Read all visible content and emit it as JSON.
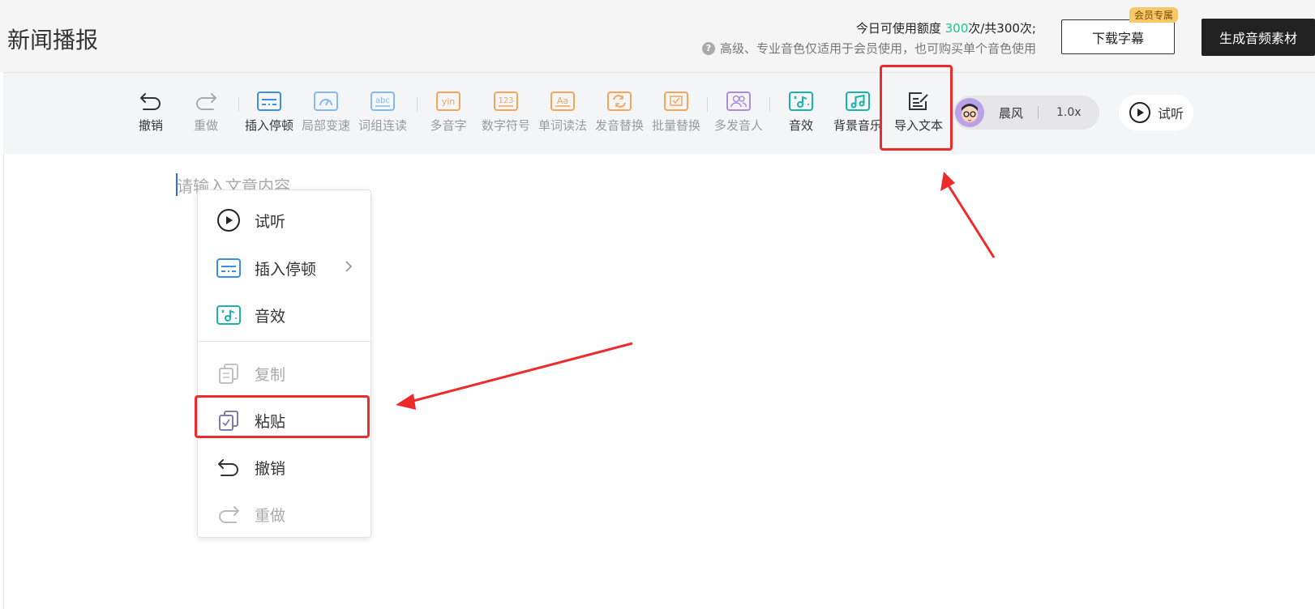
{
  "header": {
    "title": "新闻播报",
    "quota_prefix": "今日可使用额度 ",
    "quota_used": "300",
    "quota_suffix": "次/共300次;",
    "tip": "高级、专业音色仅适用于会员使用，也可购买单个音色使用",
    "download_label": "下载字幕",
    "member_badge": "会员专属",
    "generate_label": "生成音频素材"
  },
  "toolbar": {
    "undo": "撤销",
    "redo": "重做",
    "insert_pause": "插入停顿",
    "local_speed": "局部变速",
    "word_group": "词组连读",
    "polyphone": "多音字",
    "number_symbol": "数字符号",
    "word_reading": "单词读法",
    "pronunciation_replace": "发音替换",
    "batch_replace": "批量替换",
    "multi_speaker": "多发音人",
    "sound_effect": "音效",
    "bg_music": "背景音乐",
    "import_text": "导入文本"
  },
  "voice": {
    "name": "晨风",
    "speed": "1.0x"
  },
  "preview_label": "试听",
  "editor": {
    "placeholder": "请输入文章内容"
  },
  "context_menu": {
    "items": [
      {
        "label": "试听",
        "icon": "play-icon",
        "enabled": true
      },
      {
        "label": "插入停顿",
        "icon": "pause-insert-icon",
        "enabled": true,
        "submenu": true
      },
      {
        "label": "音效",
        "icon": "sound-effect-icon",
        "enabled": true
      },
      {
        "label": "复制",
        "icon": "copy-icon",
        "enabled": false
      },
      {
        "label": "粘贴",
        "icon": "paste-icon",
        "enabled": true,
        "highlighted": true
      },
      {
        "label": "撤销",
        "icon": "undo-icon",
        "enabled": true
      },
      {
        "label": "重做",
        "icon": "redo-icon",
        "enabled": false
      }
    ]
  },
  "colors": {
    "accent_green": "#1fbf8f",
    "highlight_red": "#ee2b2b",
    "blue_icon": "#3a8ee6",
    "orange_icon": "#f5a45a",
    "teal_icon": "#19b3a8",
    "purple_icon": "#a98be0"
  }
}
